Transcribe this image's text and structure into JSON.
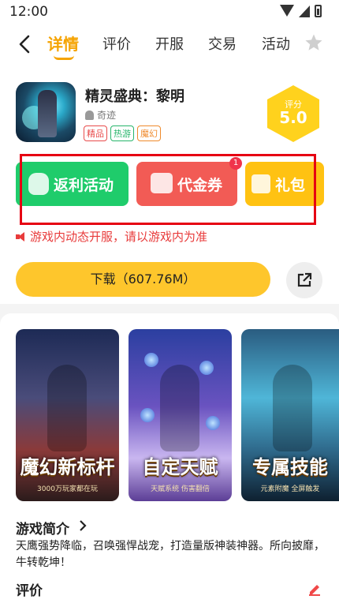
{
  "status_bar": {
    "time": "12:00"
  },
  "nav": {
    "tabs": [
      {
        "label": "详情",
        "active": true
      },
      {
        "label": "评价",
        "active": false
      },
      {
        "label": "开服",
        "active": false
      },
      {
        "label": "交易",
        "active": false
      },
      {
        "label": "活动",
        "active": false
      }
    ]
  },
  "game": {
    "title": "精灵盛典：黎明",
    "developer": "奇迹",
    "tags": [
      "精品",
      "热游",
      "魔幻"
    ],
    "score_label": "评分",
    "score": "5.0"
  },
  "actions": {
    "rebate_label": "返利活动",
    "voucher_label": "代金券",
    "voucher_badge": "1",
    "gift_label": "礼包"
  },
  "notice": "游戏内动态开服，请以游戏内为准",
  "download_label": "下载（607.76M）",
  "screenshots": [
    {
      "caption": "魔幻新标杆",
      "sub": "3000万玩家都在玩"
    },
    {
      "caption": "自定天赋",
      "sub": "天赋系统 伤害翻倍"
    },
    {
      "caption": "专属技能",
      "sub": "元素附魔 全屏触发"
    }
  ],
  "intro": {
    "title": "游戏简介",
    "text": "天鹰强势降临，召唤强悍战宠，打造量版神装神器。所向披靡，牛转乾坤！"
  },
  "reviews": {
    "title": "评价"
  },
  "colors": {
    "accent": "#f5a300",
    "rebate": "#1fcc6b",
    "voucher": "#f25b55",
    "gift": "#ffc212",
    "download": "#fec62c",
    "notice": "#e83b3b"
  }
}
